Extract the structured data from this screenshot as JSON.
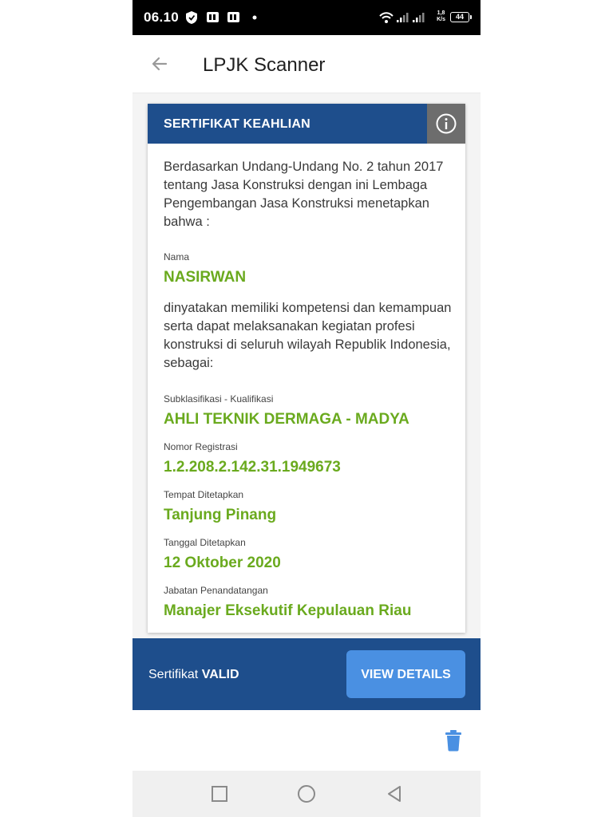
{
  "status_bar": {
    "time": "06.10",
    "net_speed_value": "1,8",
    "net_speed_unit": "K/s",
    "battery": "44"
  },
  "app_bar": {
    "title": "LPJK Scanner",
    "back_icon": "arrow-left-icon"
  },
  "card": {
    "header_title": "SERTIFIKAT KEAHLIAN",
    "info_icon": "info-icon",
    "intro": "Berdasarkan Undang-Undang No. 2 tahun 2017 tentang Jasa Konstruksi dengan ini Lembaga Pengembangan Jasa Konstruksi menetapkan bahwa :",
    "nama_label": "Nama",
    "nama_value": "NASIRWAN",
    "statement": "dinyatakan memiliki kompetensi dan kemampuan serta dapat melaksanakan kegiatan profesi konstruksi di seluruh wilayah Republik Indonesia, sebagai:",
    "subklasifikasi_label": "Subklasifikasi - Kualifikasi",
    "subklasifikasi_value": "AHLI TEKNIK DERMAGA - MADYA",
    "nomor_label": "Nomor Registrasi",
    "nomor_value": "1.2.208.2.142.31.1949673",
    "tempat_label": "Tempat Ditetapkan",
    "tempat_value": "Tanjung Pinang",
    "tanggal_label": "Tanggal Ditetapkan",
    "tanggal_value": "12 Oktober 2020",
    "jabatan_label": "Jabatan Penandatangan",
    "jabatan_value": "Manajer Eksekutif Kepulauan Riau"
  },
  "valid_bar": {
    "prefix": "Sertifikat",
    "status": "VALID",
    "button_label": "VIEW DETAILS"
  },
  "actions": {
    "trash_icon": "trash-icon"
  },
  "colors": {
    "primary": "#1e4e8c",
    "accent": "#4a90e2",
    "value_green": "#6aaa1e",
    "info_gray": "#6d6d6d"
  }
}
